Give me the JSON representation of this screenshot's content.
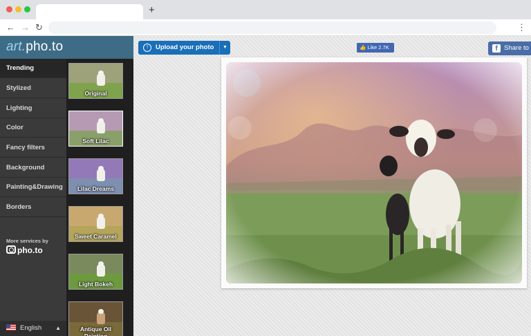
{
  "browser": {
    "new_tab_label": "+",
    "back_label": "←",
    "forward_label": "→",
    "reload_label": "↻",
    "menu_label": "⋮"
  },
  "app": {
    "logo_prefix": "art.",
    "logo_suffix": "pho.to"
  },
  "categories": [
    {
      "label": "Trending"
    },
    {
      "label": "Stylized"
    },
    {
      "label": "Lighting"
    },
    {
      "label": "Color"
    },
    {
      "label": "Fancy filters"
    },
    {
      "label": "Background"
    },
    {
      "label": "Painting&Drawing"
    },
    {
      "label": "Borders"
    }
  ],
  "more_services": {
    "label": "More services by",
    "brand": "pho.to"
  },
  "language": {
    "label": "English",
    "caret": "▲"
  },
  "thumbnails": [
    {
      "label": "Original",
      "sky": "#9ea27a",
      "ground": "#7fa34c"
    },
    {
      "label": "Soft Lilac",
      "sky": "#b69ab3",
      "ground": "#8aa06a"
    },
    {
      "label": "Lilac Dreams",
      "sky": "#9479b8",
      "ground": "#7e8fb0"
    },
    {
      "label": "Sweet Caramel",
      "sky": "#c9a870",
      "ground": "#b4a55a"
    },
    {
      "label": "Light Bokeh",
      "sky": "#7a8a5c",
      "ground": "#6d9a3f"
    },
    {
      "label": "Antique Oil Painting",
      "sky": "#6a5437",
      "ground": "#7a6a3a"
    }
  ],
  "actions": {
    "upload_label": "Upload your photo",
    "upload_icon": "upload-icon",
    "like_label": "Like 2.7K",
    "share_label": "Share to"
  },
  "colors": {
    "brand_blue": "#3e6c86",
    "upload_blue": "#1a6fb9",
    "facebook_blue": "#4267b2"
  }
}
